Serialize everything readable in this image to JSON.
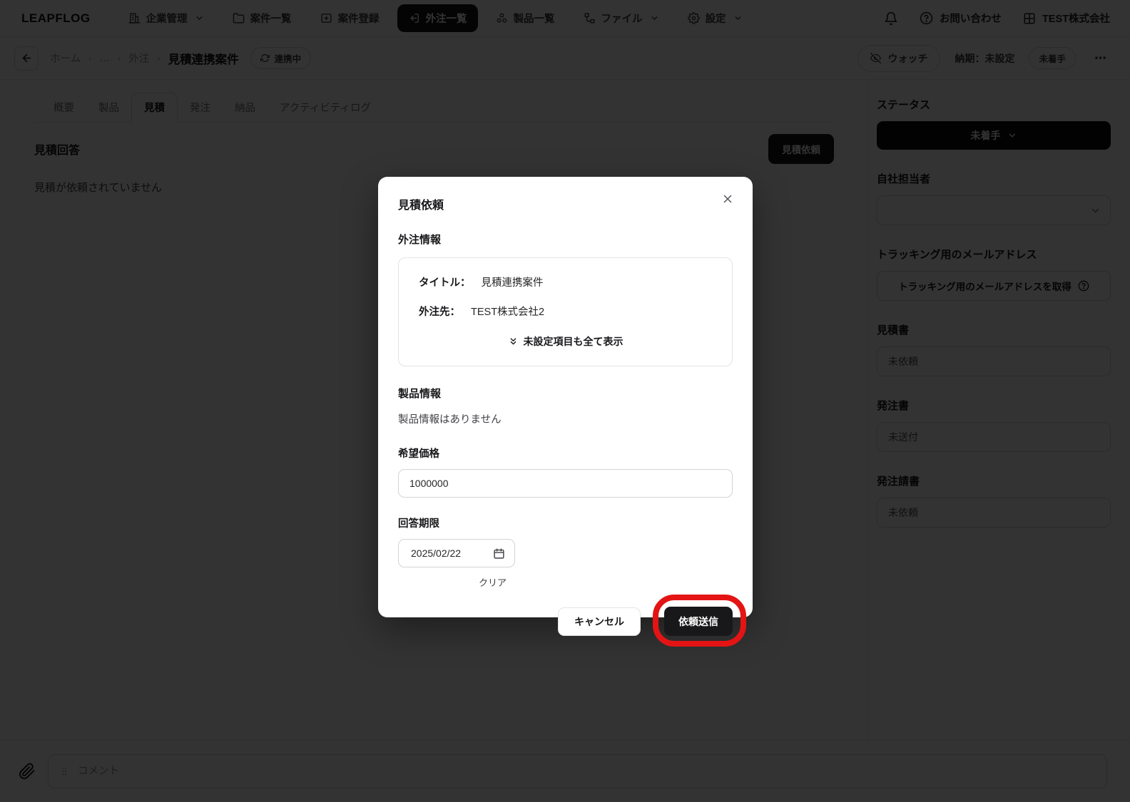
{
  "header": {
    "logo": "LEAPFLOG",
    "nav": [
      {
        "label": "企業管理"
      },
      {
        "label": "案件一覧"
      },
      {
        "label": "案件登録"
      },
      {
        "label": "外注一覧"
      },
      {
        "label": "製品一覧"
      },
      {
        "label": "ファイル"
      },
      {
        "label": "設定"
      }
    ],
    "contact": "お問い合わせ",
    "company": "TEST株式会社"
  },
  "breadcrumb": {
    "home": "ホーム",
    "ellipsis": "…",
    "parent": "外注",
    "current": "見積連携案件",
    "link_badge": "連携中",
    "watch": "ウォッチ",
    "due": "納期：未設定",
    "state": "未着手",
    "more": "⋯"
  },
  "tabs": [
    {
      "label": "概要"
    },
    {
      "label": "製品"
    },
    {
      "label": "見積"
    },
    {
      "label": "発注"
    },
    {
      "label": "納品"
    },
    {
      "label": "アクティビティログ"
    }
  ],
  "content": {
    "section_title": "見積回答",
    "empty_message": "見積が依頼されていません",
    "request_button": "見積依頼"
  },
  "sidebar": {
    "status_label": "ステータス",
    "status_value": "未着手",
    "assignee_label": "自社担当者",
    "tracking_label": "トラッキング用のメールアドレス",
    "tracking_button": "トラッキング用のメールアドレスを取得",
    "quote_label": "見積書",
    "quote_value": "未依頼",
    "order_label": "発注書",
    "order_value": "未送付",
    "order_confirm_label": "発注請書",
    "order_confirm_value": "未依頼"
  },
  "modal": {
    "title": "見積依頼",
    "outsource_heading": "外注情報",
    "title_row": {
      "label": "タイトル：",
      "value": "見積連携案件"
    },
    "vendor_row": {
      "label": "外注先：",
      "value": "TEST株式会社2"
    },
    "show_all": "未設定項目も全て表示",
    "product_heading": "製品情報",
    "product_empty": "製品情報はありません",
    "price_label": "希望価格",
    "price_value": "1000000",
    "deadline_label": "回答期限",
    "deadline_value": "2025/02/22",
    "clear": "クリア",
    "cancel": "キャンセル",
    "submit": "依頼送信"
  },
  "footer": {
    "comment_placeholder": "コメント"
  },
  "colors": {
    "accent_dark": "#18181b",
    "annotation_red": "#e41414",
    "overlay": "rgba(0,0,0,0.80)",
    "border": "#d4d4d8"
  }
}
